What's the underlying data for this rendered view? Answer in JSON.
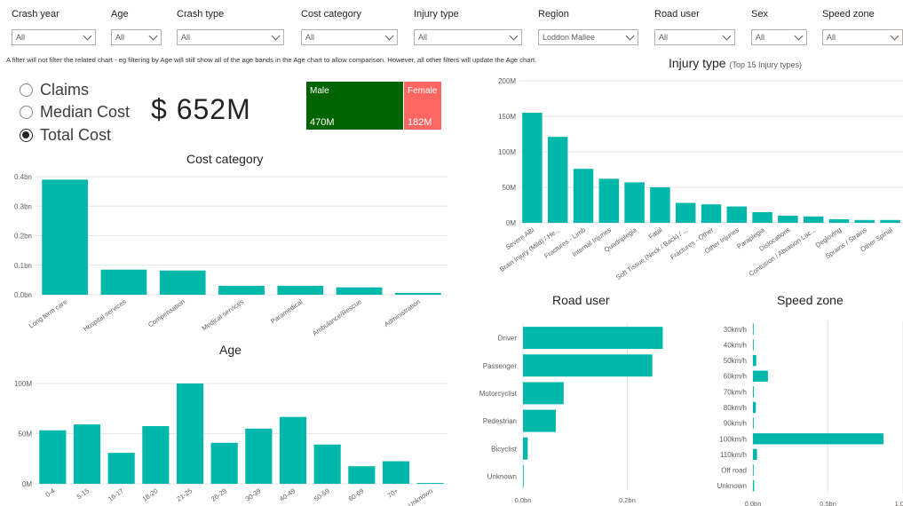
{
  "filters": [
    {
      "label": "Crash year",
      "value": "All"
    },
    {
      "label": "Age",
      "value": "All"
    },
    {
      "label": "Crash type",
      "value": "All"
    },
    {
      "label": "Cost category",
      "value": "All"
    },
    {
      "label": "Injury type",
      "value": "All"
    },
    {
      "label": "Region",
      "value": "Loddon Mallee"
    },
    {
      "label": "Road user",
      "value": "All"
    },
    {
      "label": "Sex",
      "value": "All"
    },
    {
      "label": "Speed zone",
      "value": "All"
    }
  ],
  "note": "A filter will not filter the related chart - eg filtering by Age will still show all of the age bands in the Age chart to allow comparison. However, all other filters will update the Age chart.",
  "measure_options": [
    {
      "label": "Claims",
      "selected": false
    },
    {
      "label": "Median Cost",
      "selected": false
    },
    {
      "label": "Total Cost",
      "selected": true
    }
  ],
  "kpi_value": "$ 652M",
  "sex_treemap": [
    {
      "label": "Male",
      "value_text": "470M",
      "value": 470,
      "color": "#006400"
    },
    {
      "label": "Female",
      "value_text": "182M",
      "value": 182,
      "color": "#ff6661"
    }
  ],
  "colors": {
    "bar": "#00b8aa",
    "grid": "#e6e6e6",
    "axis_text": "#605e5c"
  },
  "chart_data": [
    {
      "type": "bar",
      "title": "Cost category",
      "categories": [
        "Long term care",
        "Hospital services",
        "Compensation",
        "Medical services",
        "Paramedical",
        "Ambulance/Rescue",
        "Administration"
      ],
      "values": [
        0.39,
        0.085,
        0.082,
        0.03,
        0.03,
        0.025,
        0.006
      ],
      "ylim": [
        0,
        0.4
      ],
      "yticks": [
        "0.0bn",
        "0.1bn",
        "0.2bn",
        "0.3bn",
        "0.4bn"
      ],
      "grid": true
    },
    {
      "type": "bar",
      "title": "Injury type",
      "subtitle": "(Top 15 Injury types)",
      "categories": [
        "Severe ABI",
        "Brain Injury (Mild) / He...",
        "Fractures - Limb",
        "Internal Injuries",
        "Quadriplegia",
        "Fatal",
        "Soft Tissue (Neck / Back) / ...",
        "Fractures - Other",
        "Other Injuries",
        "Paraplegia",
        "Dislocations",
        "Contusion / Abrasion Lac...",
        "Degloving",
        "Sprains / Strains",
        "Other Spinal"
      ],
      "values": [
        155,
        121,
        76,
        62,
        57,
        50,
        28,
        26,
        23,
        15,
        10,
        9,
        5,
        4,
        4
      ],
      "ylim": [
        0,
        200
      ],
      "yticks": [
        "0M",
        "50M",
        "100M",
        "150M",
        "200M"
      ],
      "grid": true
    },
    {
      "type": "bar",
      "title": "Age",
      "categories": [
        "0-4",
        "5-15",
        "16-17",
        "18-20",
        "21-25",
        "26-29",
        "30-39",
        "40-49",
        "50-59",
        "60-69",
        "70+",
        "Unknown"
      ],
      "values": [
        64,
        71,
        37,
        69,
        120,
        49,
        66,
        80,
        47,
        21,
        27,
        1
      ],
      "ylim": [
        0,
        120
      ],
      "yticks": [
        "0M",
        "50M",
        "100M"
      ],
      "grid": true
    },
    {
      "type": "bar",
      "orientation": "horizontal",
      "title": "Road user",
      "categories": [
        "Driver",
        "Passenger",
        "Motorcyclist",
        "Pedestrian",
        "Bicyclist",
        "Unknown"
      ],
      "values": [
        0.268,
        0.248,
        0.078,
        0.063,
        0.009,
        0.0
      ],
      "xlim": [
        0,
        0.4
      ],
      "xticks": [
        "0.0bn",
        "0.2bn"
      ],
      "grid": true
    },
    {
      "type": "bar",
      "orientation": "horizontal",
      "title": "Speed zone",
      "categories": [
        "30km/h",
        "40km/h",
        "50km/h",
        "60km/h",
        "70km/h",
        "80km/h",
        "90km/h",
        "100km/h",
        "110km/h",
        "Off road",
        "Unknown"
      ],
      "values": [
        0.0,
        0.005,
        0.022,
        0.1,
        0.006,
        0.019,
        0.005,
        0.87,
        0.027,
        0.003,
        0.008
      ],
      "xlim": [
        0,
        1.0
      ],
      "xticks": [
        "0.0bn",
        "0.5bn",
        "1.0bn"
      ],
      "grid": true
    }
  ]
}
